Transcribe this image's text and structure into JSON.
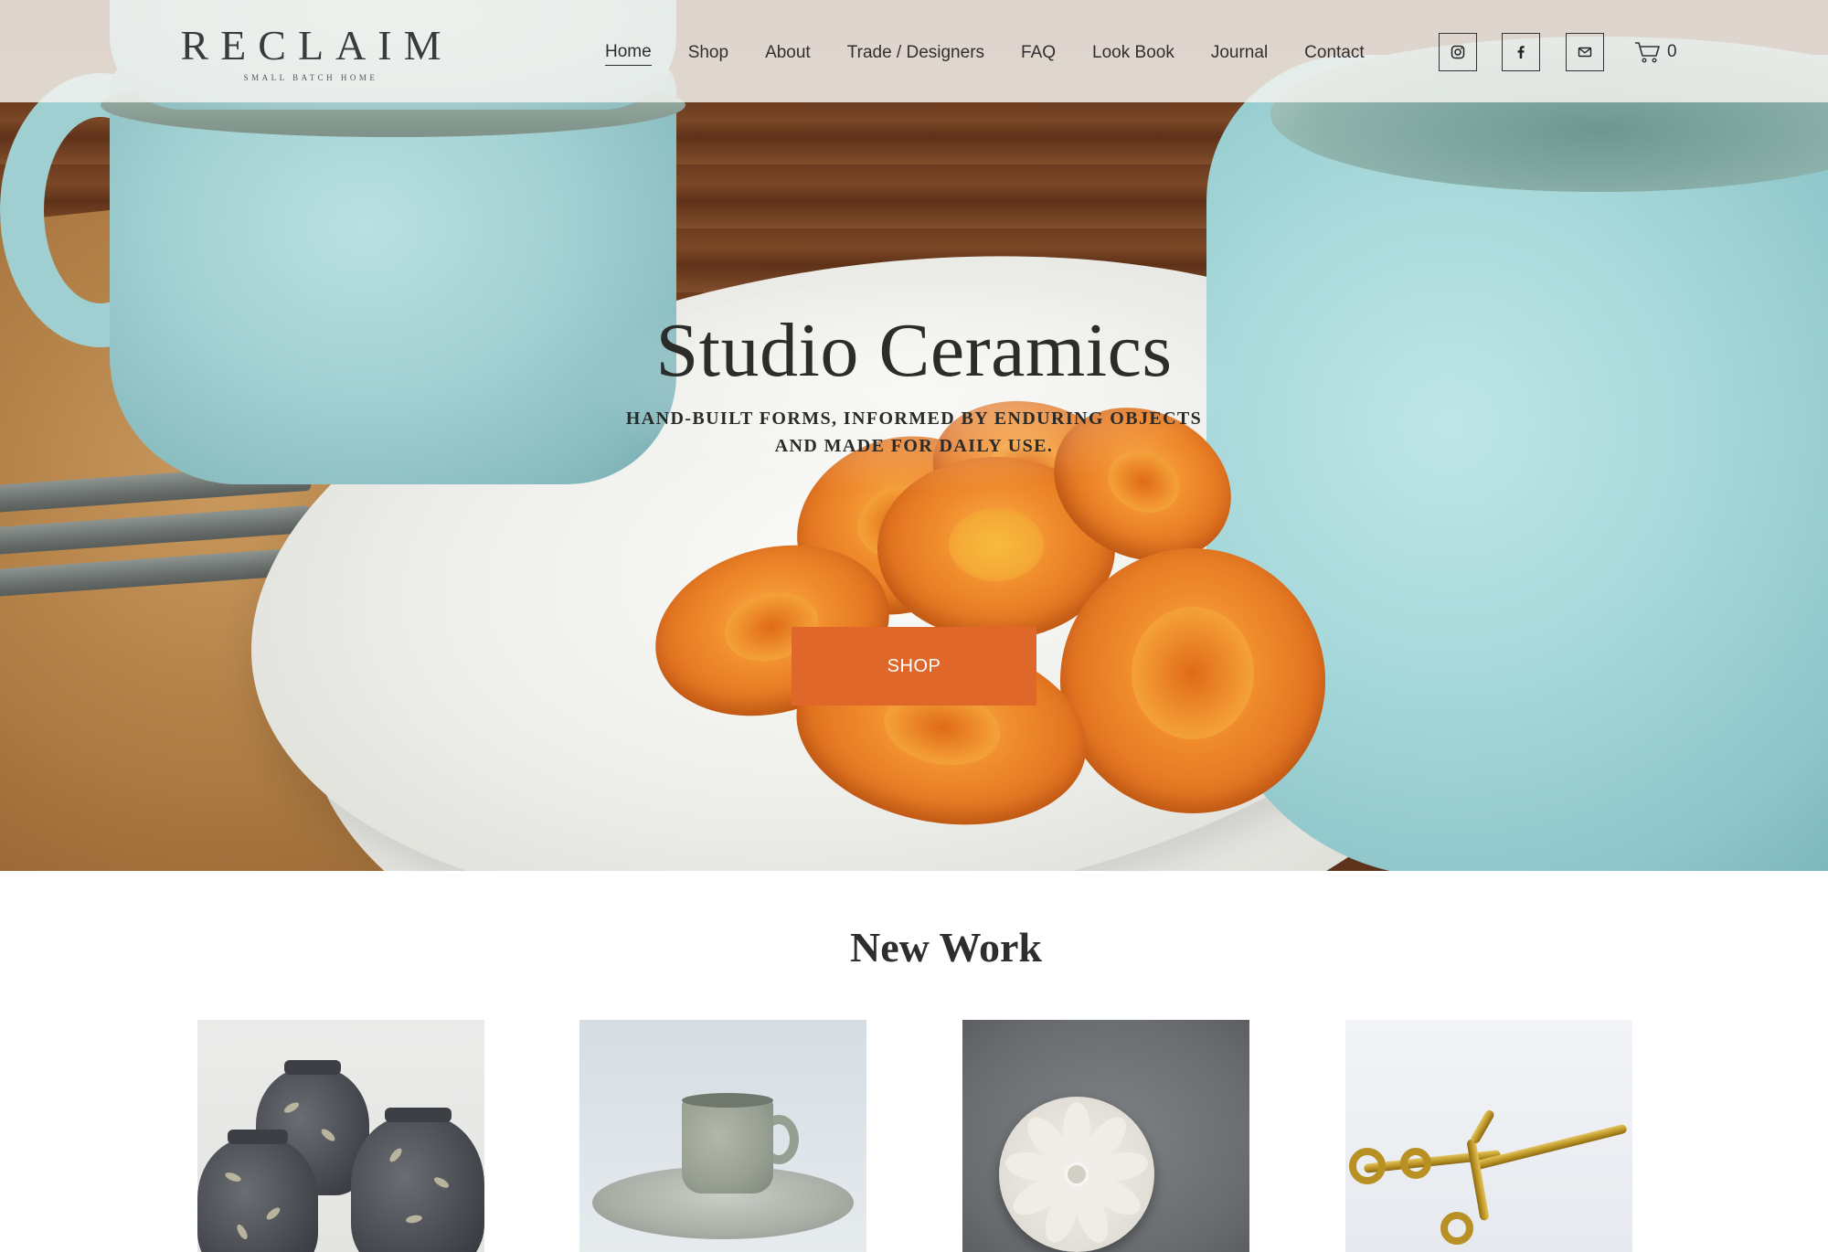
{
  "header": {
    "logo": {
      "name": "RECLAIM",
      "tagline": "SMALL BATCH HOME"
    },
    "nav": [
      {
        "label": "Home",
        "active": true
      },
      {
        "label": "Shop",
        "active": false
      },
      {
        "label": "About",
        "active": false
      },
      {
        "label": "Trade / Designers",
        "active": false
      },
      {
        "label": "FAQ",
        "active": false
      },
      {
        "label": "Look Book",
        "active": false
      },
      {
        "label": "Journal",
        "active": false
      },
      {
        "label": "Contact",
        "active": false
      }
    ],
    "social": [
      {
        "icon": "instagram-icon"
      },
      {
        "icon": "facebook-icon"
      },
      {
        "icon": "email-icon"
      }
    ],
    "cart": {
      "icon": "cart-icon",
      "count": "0"
    }
  },
  "hero": {
    "title": "Studio Ceramics",
    "subtitle": "HAND-BUILT FORMS, INFORMED BY ENDURING OBJECTS AND MADE FOR DAILY USE.",
    "button_label": "SHOP"
  },
  "new_work": {
    "title": "New Work",
    "products": [
      {
        "image": "dark glazed jars with leaf motif"
      },
      {
        "image": "speckled grey cup and saucer"
      },
      {
        "image": "white ornamental rosette on grey"
      },
      {
        "image": "brass candle snuffer scissors"
      }
    ]
  },
  "colors": {
    "accent": "#e0672a",
    "header_bg": "#f4f3f0",
    "text": "#2b2b2b"
  }
}
